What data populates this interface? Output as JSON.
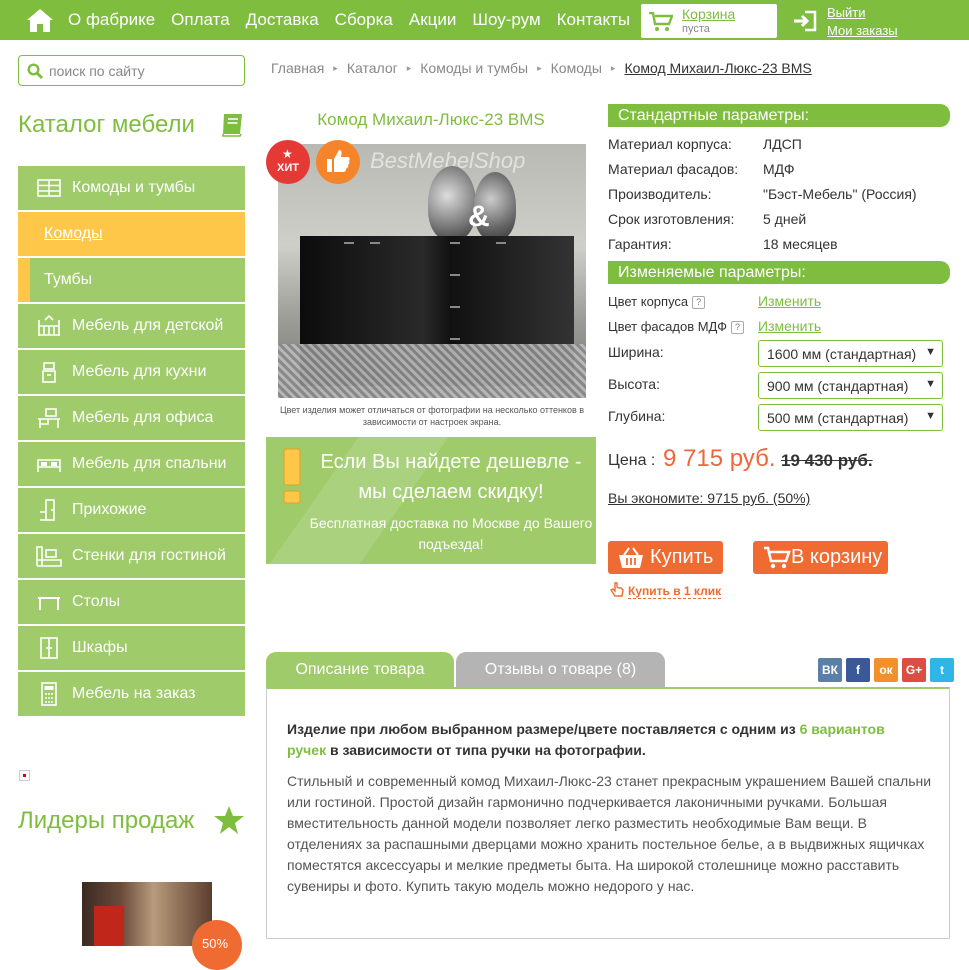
{
  "nav": {
    "items": [
      "О фабрике",
      "Оплата",
      "Доставка",
      "Сборка",
      "Акции",
      "Шоу-рум",
      "Контакты"
    ]
  },
  "cart": {
    "title": "Корзина",
    "status": "пуста"
  },
  "account": {
    "logout": "Выйти",
    "orders": "Мои заказы"
  },
  "search": {
    "placeholder": "поиск по сайту"
  },
  "catalog": {
    "title": "Каталог мебели",
    "items": [
      {
        "label": "Комоды и тумбы",
        "icon": "dresser-icon"
      },
      {
        "label": "Комоды",
        "icon": ""
      },
      {
        "label": "Тумбы",
        "icon": ""
      },
      {
        "label": "Мебель для детской",
        "icon": "crib-icon"
      },
      {
        "label": "Мебель для кухни",
        "icon": "kitchen-icon"
      },
      {
        "label": "Мебель для офиса",
        "icon": "desk-icon"
      },
      {
        "label": "Мебель для спальни",
        "icon": "bed-icon"
      },
      {
        "label": "Прихожие",
        "icon": "hallway-icon"
      },
      {
        "label": "Стенки для гостиной",
        "icon": "tv-wall-icon"
      },
      {
        "label": "Столы",
        "icon": "table-icon"
      },
      {
        "label": "Шкафы",
        "icon": "wardrobe-icon"
      },
      {
        "label": "Мебель на заказ",
        "icon": "calculator-icon"
      }
    ]
  },
  "leaders": {
    "title": "Лидеры продаж",
    "badge": "50%"
  },
  "breadcrumb": [
    "Главная",
    "Каталог",
    "Комоды и тумбы",
    "Комоды",
    "Комод Михаил-Люкс-23 BMS"
  ],
  "product": {
    "title": "Комод Михаил-Люкс-23 BMS",
    "badge_hit": "ХИТ",
    "photo_watermark": "BestMebelShop",
    "photo_note": "Цвет изделия может отличаться от фотографии на несколько оттенков в зависимости от настроек экрана."
  },
  "promo": {
    "headline_1": "Если Вы найдете дешевле -",
    "headline_2": "мы сделаем скидку!",
    "sub": "Бесплатная доставка по Москве до Вашего подъезда!"
  },
  "standard": {
    "title": "Стандартные параметры:",
    "rows": [
      {
        "key": "Материал корпуса:",
        "value": "ЛДСП"
      },
      {
        "key": "Материал фасадов:",
        "value": "МДФ"
      },
      {
        "key": "Производитель:",
        "value": "\"Бэст-Мебель\" (Россия)"
      },
      {
        "key": "Срок изготовления:",
        "value": "5 дней"
      },
      {
        "key": "Гарантия:",
        "value": "18 месяцев"
      }
    ]
  },
  "variable": {
    "title": "Изменяемые параметры:",
    "body_color": {
      "label": "Цвет корпуса",
      "help": "?",
      "link": "Изменить"
    },
    "facade_color": {
      "label": "Цвет фасадов МДФ",
      "help": "?",
      "link": "Изменить"
    },
    "width": {
      "label": "Ширина:",
      "value": "1600 мм (стандартная)"
    },
    "height": {
      "label": "Высота:",
      "value": "900 мм (стандартная)"
    },
    "depth": {
      "label": "Глубина:",
      "value": "500 мм (стандартная)"
    }
  },
  "price": {
    "label": "Цена :",
    "new": "9 715 руб.",
    "old": "19 430 руб.",
    "savings": "Вы экономите: 9715 руб. (50%)"
  },
  "buttons": {
    "buy": "Купить",
    "to_cart": "В корзину",
    "one_click": "Купить в 1 клик"
  },
  "tabs": {
    "description": "Описание товара",
    "reviews": "Отзывы о товаре (8)"
  },
  "social": [
    "ВК",
    "f",
    "ок",
    "G+",
    "t"
  ],
  "description": {
    "lead_1": "Изделие при любом выбранном размере/цвете поставляется с одним из ",
    "lead_hl": "6 вариантов ручек",
    "lead_2": " в зависимости от типа ручки на фотографии.",
    "body": "Стильный и современный комод Михаил-Люкс-23 станет прекрасным украшением Вашей спальни или гостиной. Простой дизайн гармонично подчеркивается лаконичными ручками. Большая вместительность данной модели позволяет легко разместить необходимые Вам вещи. В отделениях за распашными дверцами можно хранить постельное белье, а в выдвижных ящичках поместятся аксессуары и мелкие предметы быта. На широкой столешнице можно расставить сувениры и фото. Купить такую модель можно недорого у нас."
  },
  "colors": {
    "brand_green": "#7fbd3f",
    "menu_green": "#9fcb6b",
    "active_yellow": "#ffc74a",
    "accent_orange": "#f06b31"
  }
}
